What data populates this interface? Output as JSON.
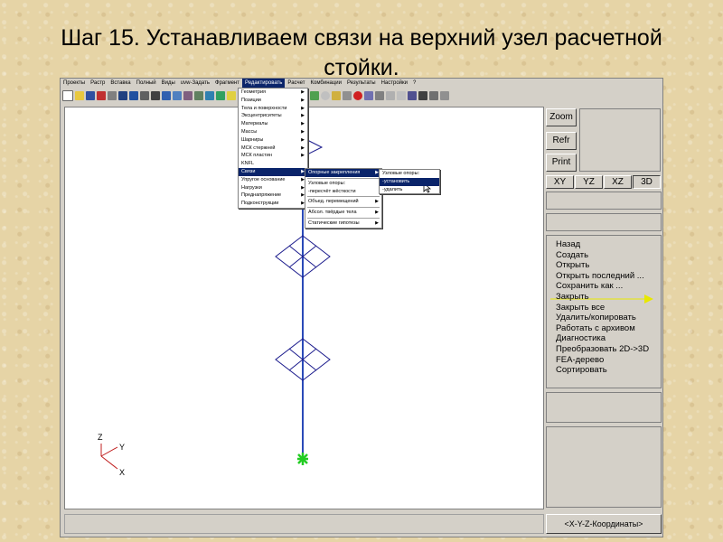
{
  "slide": {
    "title": "Шаг 15. Устанавливаем связи на верхний узел расчетной стойки."
  },
  "menubar": [
    "Проекты",
    "Растр",
    "Вставка",
    "Полный",
    "Виды",
    "uvw-Задать",
    "Фрагмент",
    "Редактировать",
    "Расчет",
    "Комбинации",
    "Результаты",
    "Настройки",
    "?"
  ],
  "menubar_active_index": 7,
  "edit_menu": {
    "items": [
      "Геометрия",
      "Позиции",
      "Тела и поверхности",
      "Эксцентриситеты",
      "Материалы",
      "Массы",
      "Шарниры",
      "МСК стержней",
      "МСК пластин",
      "KNFL",
      "Связи",
      "Упругое основание",
      "Нагрузки",
      "Преднапряжение",
      "Подконструкции"
    ],
    "has_submenu": [
      true,
      true,
      true,
      true,
      true,
      true,
      true,
      true,
      true,
      false,
      true,
      true,
      true,
      true,
      true
    ],
    "highlight_index": 10
  },
  "links_submenu": {
    "items": [
      "Опорные закрепления",
      "Узловые опоры:",
      "-пересчёт жёсткости",
      "Объед. перемещений",
      "Абсол. твёрдые тела",
      "Статические гипотезы"
    ],
    "has_submenu": [
      true,
      false,
      false,
      true,
      true,
      true
    ],
    "highlight_index": 0
  },
  "supports_submenu": {
    "items": [
      "Узловые опоры:",
      "-установить",
      "-удалить"
    ],
    "highlight_index": 1
  },
  "axes": {
    "z": "Z",
    "y": "Y",
    "x": "X"
  },
  "right_panel": {
    "zoom": "Zoom",
    "refr": "Refr",
    "print": "Print",
    "views": [
      "XY",
      "YZ",
      "XZ",
      "3D"
    ],
    "active_view": "3D",
    "commands": [
      "Назад",
      "Создать",
      "Открыть",
      "Открыть последний ...",
      "Сохранить как ...",
      "Закрыть",
      "Закрыть все",
      "Удалить/копировать",
      "Работать с архивом",
      "Диагностика",
      "Преобразовать 2D->3D",
      "FEA-дерево",
      "Сортировать"
    ],
    "highlighted_command": "Закрыть",
    "coord_button": "<X-Y-Z-Координаты>"
  },
  "colors": {
    "menu_highlight": "#0a246a",
    "structure": "#1a1a8c",
    "column": "#2a4ab8",
    "support_marker": "#22cc22",
    "pointer_arrow": "#e8e800"
  }
}
